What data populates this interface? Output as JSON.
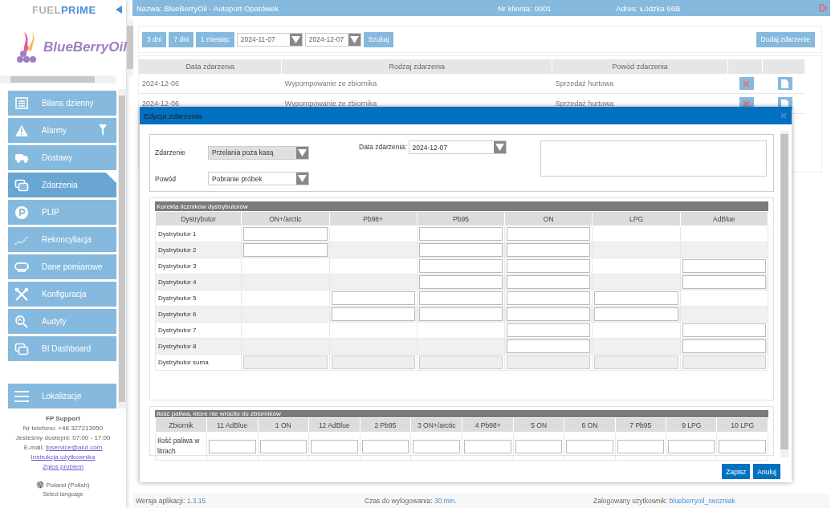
{
  "sidebar": {
    "brand_left": "FUEL",
    "brand_right": "PRIME",
    "logo_text": "BlueBerryOil",
    "items": [
      {
        "label": "Bilans dzienny",
        "selected": false
      },
      {
        "label": "Alarmy",
        "selected": false
      },
      {
        "label": "Dostawy",
        "selected": false
      },
      {
        "label": "Zdarzenia",
        "selected": true
      },
      {
        "label": "PLIP",
        "selected": false
      },
      {
        "label": "Rekoncyliacja",
        "selected": false
      },
      {
        "label": "Dane pomiarowe",
        "selected": false
      },
      {
        "label": "Konfiguracja",
        "selected": false
      },
      {
        "label": "Audyty",
        "selected": false
      },
      {
        "label": "BI Dashboard",
        "selected": false
      }
    ],
    "bottom_item": {
      "label": "Lokalizacje"
    },
    "support": {
      "title": "FP Support",
      "lines": [
        "Nr telefonu: +48 327213950",
        "Jesteśmy dostepni: 07:00 - 17:00"
      ],
      "email_label": "E-mail:",
      "email": "fpservice@aiut.com",
      "links": [
        "Instrukcja użytkownika",
        "Zgłoś problem"
      ]
    },
    "language": "Poland (Polish)",
    "language_hint": "Select language"
  },
  "header": {
    "name": "Nazwa: BlueBerryOil - Autoport Opatówek",
    "client": "Nr klienta: 0001",
    "address": "Adres: Łódzka 66B"
  },
  "toolbar": {
    "ranges": [
      "3 dni",
      "7 dni",
      "1 miesiąc"
    ],
    "date_from": "2024-11-07",
    "date_to": "2024-12-07",
    "search": "Szukaj",
    "add": "Dodaj zdarzenie"
  },
  "events": {
    "columns": [
      "Data zdarzenia",
      "Rodzaj zdarzenia",
      "Powód zdarzenia"
    ],
    "rows": [
      [
        "2024-12-06",
        "Wypompowanie ze zbiornika",
        "Sprzedaż hurtowa"
      ],
      [
        "2024-12-06",
        "Wypompowanie ze zbiornika",
        "Sprzedaż hurtowa"
      ]
    ]
  },
  "modal": {
    "title": "Edycja zdarzenia",
    "fields": [
      {
        "label": "Zdarzenie",
        "value": "Przelania poza kasą",
        "disabled": true
      },
      {
        "label": "Powód",
        "value": "Pobranie próbek",
        "disabled": false
      }
    ],
    "date_label": "Data zdarzenia:",
    "date_value": "2024-12-07",
    "correction": {
      "title": "Korekta liczników dystrybutorów",
      "columns": [
        "Dystrybutor",
        "ON+/arctic",
        "Pb98+",
        "Pb95",
        "ON",
        "LPG",
        "AdBlue"
      ],
      "rows": [
        {
          "label": "Dystrybutor 1",
          "cells": [
            {
              "kind": "input"
            },
            {
              "kind": "none"
            },
            {
              "kind": "input"
            },
            {
              "kind": "input"
            },
            {
              "kind": "none"
            },
            {
              "kind": "none"
            }
          ]
        },
        {
          "label": "Dystrybutor 2",
          "cells": [
            {
              "kind": "input"
            },
            {
              "kind": "none"
            },
            {
              "kind": "input"
            },
            {
              "kind": "input"
            },
            {
              "kind": "none"
            },
            {
              "kind": "none"
            }
          ]
        },
        {
          "label": "Dystrybutor 3",
          "cells": [
            {
              "kind": "none"
            },
            {
              "kind": "none"
            },
            {
              "kind": "input"
            },
            {
              "kind": "input"
            },
            {
              "kind": "none"
            },
            {
              "kind": "input"
            }
          ]
        },
        {
          "label": "Dystrybutor 4",
          "cells": [
            {
              "kind": "none"
            },
            {
              "kind": "none"
            },
            {
              "kind": "input"
            },
            {
              "kind": "input"
            },
            {
              "kind": "none"
            },
            {
              "kind": "input"
            }
          ]
        },
        {
          "label": "Dystrybutor 5",
          "cells": [
            {
              "kind": "none"
            },
            {
              "kind": "input"
            },
            {
              "kind": "input"
            },
            {
              "kind": "input"
            },
            {
              "kind": "input"
            },
            {
              "kind": "none"
            }
          ]
        },
        {
          "label": "Dystrybutor 6",
          "cells": [
            {
              "kind": "none"
            },
            {
              "kind": "input"
            },
            {
              "kind": "input"
            },
            {
              "kind": "input"
            },
            {
              "kind": "input"
            },
            {
              "kind": "none"
            }
          ]
        },
        {
          "label": "Dystrybutor 7",
          "cells": [
            {
              "kind": "none"
            },
            {
              "kind": "none"
            },
            {
              "kind": "none"
            },
            {
              "kind": "input"
            },
            {
              "kind": "none"
            },
            {
              "kind": "input"
            }
          ]
        },
        {
          "label": "Dystrybutor 8",
          "cells": [
            {
              "kind": "none"
            },
            {
              "kind": "none"
            },
            {
              "kind": "none"
            },
            {
              "kind": "input"
            },
            {
              "kind": "none"
            },
            {
              "kind": "input"
            }
          ]
        },
        {
          "label": "Dystrybutor suma",
          "cells": [
            {
              "kind": "readonly"
            },
            {
              "kind": "readonly"
            },
            {
              "kind": "readonly"
            },
            {
              "kind": "readonly"
            },
            {
              "kind": "readonly"
            },
            {
              "kind": "readonly"
            }
          ]
        }
      ]
    },
    "returned": {
      "title": "Ilość paliwa, które nie wróciło do zbiorników",
      "columns": [
        "Zbiornik",
        "11 AdBlue",
        "1 ON",
        "12 AdBlue",
        "2 Pb95",
        "3 ON+/arctic",
        "4 Pb98+",
        "5 ON",
        "6 ON",
        "7 Pb95",
        "9 LPG",
        "10 LPG"
      ],
      "row_label": "Ilość paliwa w litrach"
    },
    "buttons": [
      "Zapisz",
      "Anuluj"
    ]
  },
  "footer": [
    {
      "label": "Wersja aplikacji:",
      "value": "1.3.15"
    },
    {
      "label": "Czas do wylogowania:",
      "value": "30 min."
    },
    {
      "label": "Zalogowany użytkownik:",
      "value": "blueberryoil_rwozniak"
    }
  ]
}
